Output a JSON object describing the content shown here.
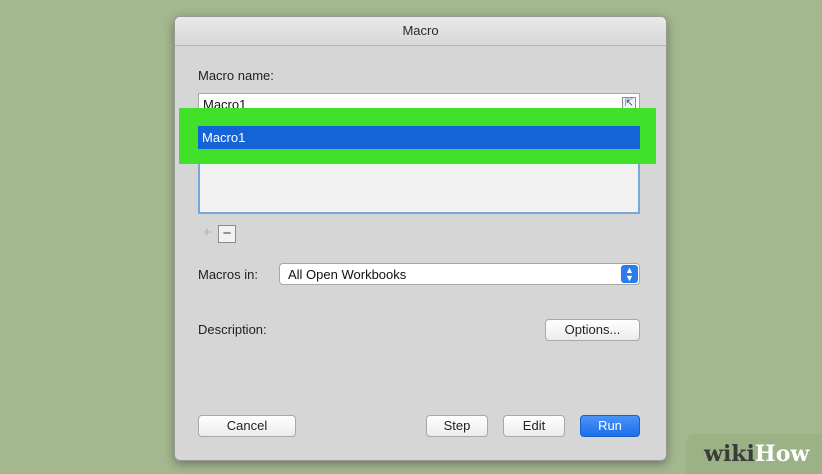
{
  "dialog": {
    "title": "Macro",
    "macro_name_label": "Macro name:",
    "macro_name_value": "Macro1",
    "macro_list": [
      "Macro1"
    ],
    "add_symbol": "+",
    "remove_symbol": "−",
    "macros_in_label": "Macros in:",
    "macros_in_value": "All Open Workbooks",
    "description_label": "Description:",
    "options_label": "Options...",
    "cancel_label": "Cancel",
    "step_label": "Step",
    "edit_label": "Edit",
    "run_label": "Run"
  },
  "watermark": {
    "wiki": "wiki",
    "how": "How"
  },
  "colors": {
    "background": "#a3b88f",
    "highlight": "#41e02a",
    "selection": "#1464d7",
    "primary_button": "#1d6fe8"
  },
  "icons": {
    "collapse": "collapse-dialog-icon",
    "select_arrows": "up-down-arrows-icon"
  }
}
